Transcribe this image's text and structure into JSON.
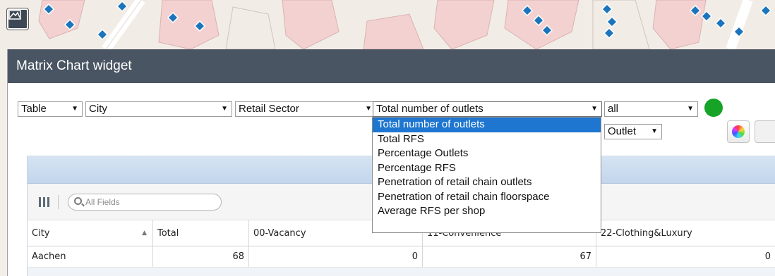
{
  "widget": {
    "title": "Matrix Chart widget"
  },
  "controls": {
    "view": "Table",
    "rows": "City",
    "columns": "Retail Sector",
    "measure": "Total number of outlets",
    "filter": "all",
    "unit": "Outlet",
    "status_color": "#17a328"
  },
  "measure_options": [
    "Total number of outlets",
    "Total RFS",
    "Percentage Outlets",
    "Percentage RFS",
    "Penetration of retail chain outlets",
    "Penetration of retail chain floorspace",
    "Average RFS per shop"
  ],
  "grid": {
    "search_placeholder": "All Fields",
    "headers": [
      "City",
      "Total",
      "00-Vacancy",
      "11-Convenience",
      "22-Clothing&Luxury"
    ],
    "rows": [
      {
        "city": "Aachen",
        "total": "68",
        "vacancy": "0",
        "convenience": "67",
        "clothing": "0"
      }
    ]
  },
  "icons": {
    "map_button": "layers-icon",
    "columns": "columns-icon",
    "search": "search-icon",
    "color": "color-wheel-icon",
    "sort": "sort-ascending-icon"
  },
  "colors": {
    "titlebar": "#4a5563",
    "selection": "#1e76d0",
    "grid_band": "#c9dbee",
    "map_marker": "#1c75bc"
  }
}
